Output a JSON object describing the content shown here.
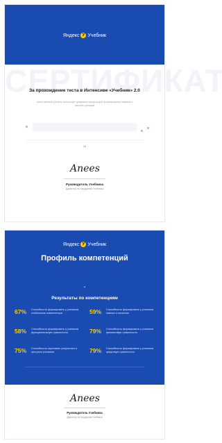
{
  "brand": {
    "name": "Яндекс",
    "logo_letter": "У",
    "product": "Учебник"
  },
  "certificate": {
    "watermark": "СЕРТИФИКАТ",
    "title": "За прохождение теста в Интенсиве «Учебник» 2.0",
    "description": "Качественный учитель использует цифровые ресурсы для формирования навыков и качеств учеников",
    "date": "18",
    "signer_name": "Руководитель Учебника",
    "signer_role": "Директор по продуктам Учебника"
  },
  "profile": {
    "title": "Профиль компетенций",
    "subtitle": "Результаты по компетенциям",
    "competencies": [
      {
        "percent": "67%",
        "text": "Способность формировать у учеников глобальные компетенции"
      },
      {
        "percent": "59%",
        "text": "Способность формировать у учеников навыки и качества"
      },
      {
        "percent": "58%",
        "text": "Способность формировать у учеников функциональную грамотность"
      },
      {
        "percent": "79%",
        "text": "Способность формировать у учеников финансовую грамотность"
      },
      {
        "percent": "75%",
        "text": "Способность оценивать результаты и прогресс учеников"
      },
      {
        "percent": "79%",
        "text": "Способность формировать у учеников цифровую грамотность"
      }
    ],
    "signer_name": "Руководитель Учебника",
    "signer_role": "Директор по продуктам Учебника"
  },
  "signature_text": "Anees"
}
